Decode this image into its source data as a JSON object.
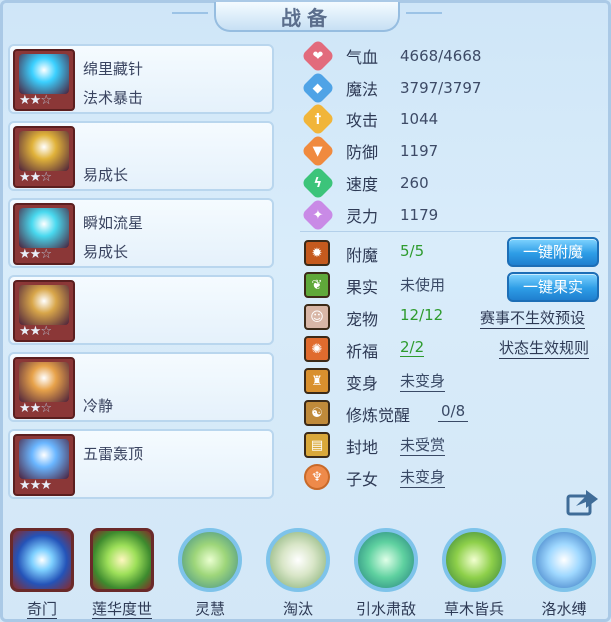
{
  "title": "战备",
  "equipment": [
    {
      "line1": "绵里藏针",
      "line2": "法术暴击",
      "stars_filled": 2,
      "stars_total": 3,
      "color": "#3bd0ff"
    },
    {
      "line1": "",
      "line2": "易成长",
      "stars_filled": 2,
      "stars_total": 3,
      "color": "#e0b23a"
    },
    {
      "line1": "瞬如流星",
      "line2": "易成长",
      "stars_filled": 2,
      "stars_total": 3,
      "color": "#49d9ef"
    },
    {
      "line1": "",
      "line2": "",
      "stars_filled": 2,
      "stars_total": 3,
      "color": "#d8a64a"
    },
    {
      "line1": "",
      "line2": "冷静",
      "stars_filled": 2,
      "stars_total": 3,
      "color": "#e7a24a"
    },
    {
      "line1": "五雷轰顶",
      "line2": "",
      "stars_filled": 3,
      "stars_total": 3,
      "color": "#6ab6ff"
    }
  ],
  "stats": [
    {
      "label": "气血",
      "value": "4668/4668",
      "icon": "heart-icon",
      "color": "#e26b7c",
      "glyph": "❤"
    },
    {
      "label": "魔法",
      "value": "3797/3797",
      "icon": "magic-icon",
      "color": "#4fa3e6",
      "glyph": "◆"
    },
    {
      "label": "攻击",
      "value": "1044",
      "icon": "sword-icon",
      "color": "#f1b53a",
      "glyph": "†"
    },
    {
      "label": "防御",
      "value": "1197",
      "icon": "shield-icon",
      "color": "#f08a3e",
      "glyph": "▼"
    },
    {
      "label": "速度",
      "value": "260",
      "icon": "speed-icon",
      "color": "#3cc47a",
      "glyph": "ϟ"
    },
    {
      "label": "灵力",
      "value": "1179",
      "icon": "spirit-icon",
      "color": "#c98ae6",
      "glyph": "✦"
    }
  ],
  "options": [
    {
      "label": "附魔",
      "value": "5/5",
      "style": "green",
      "icon": "enchant-icon"
    },
    {
      "label": "果实",
      "value": "未使用",
      "style": "plain",
      "icon": "fruit-icon"
    },
    {
      "label": "宠物",
      "value": "12/12",
      "style": "green",
      "icon": "pet-icon"
    },
    {
      "label": "祈福",
      "value": "2/2",
      "style": "green-underline",
      "icon": "blessing-icon"
    },
    {
      "label": "变身",
      "value": "未变身",
      "style": "underline",
      "icon": "transform-icon"
    },
    {
      "label": "修炼觉醒",
      "value": "0/8",
      "style": "underline",
      "icon": "cultivate-icon"
    },
    {
      "label": "封地",
      "value": "未受赏",
      "style": "underline",
      "icon": "fief-icon"
    },
    {
      "label": "子女",
      "value": "未变身",
      "style": "underline",
      "icon": "child-icon"
    }
  ],
  "buttons": {
    "enchant": "一键附魔",
    "fruit": "一键果实"
  },
  "links": {
    "event_preset": "赛事不生效预设",
    "status_rules": "状态生效规则"
  },
  "skills": [
    {
      "name": "奇门",
      "kind": "square",
      "underline": true
    },
    {
      "name": "莲华度世",
      "kind": "square",
      "underline": true
    },
    {
      "name": "灵慧",
      "kind": "round",
      "underline": false
    },
    {
      "name": "淘汰",
      "kind": "round",
      "underline": false
    },
    {
      "name": "引水肃敌",
      "kind": "round",
      "underline": false
    },
    {
      "name": "草木皆兵",
      "kind": "round",
      "underline": false
    },
    {
      "name": "洛水缚",
      "kind": "round",
      "underline": false
    }
  ]
}
